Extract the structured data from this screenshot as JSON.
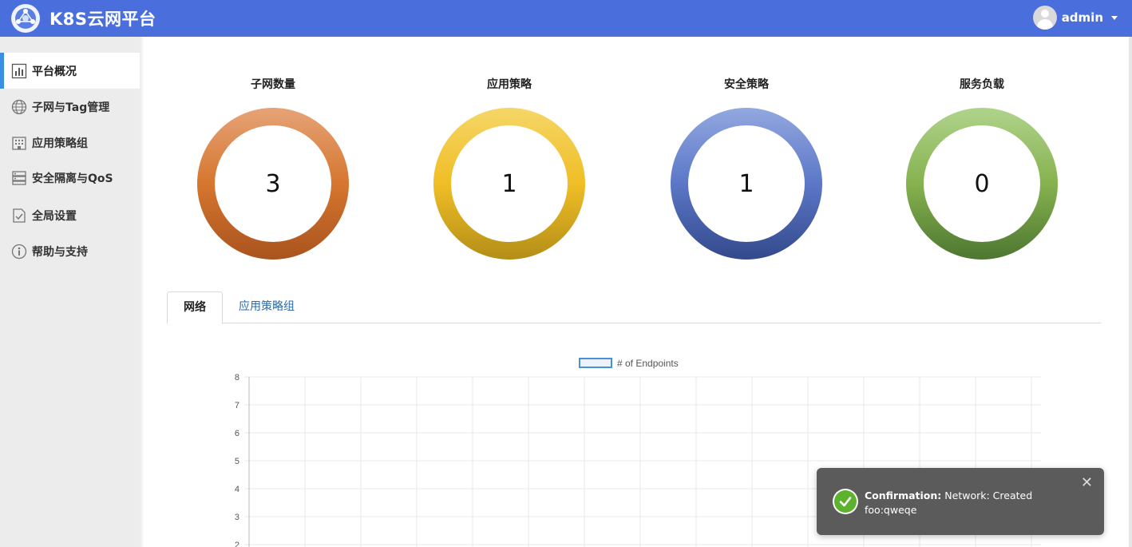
{
  "header": {
    "brand": "K8S云网平台",
    "user": "admin"
  },
  "sidebar": {
    "items": [
      {
        "label": "平台概况",
        "icon": "bar-chart-icon",
        "active": true
      },
      {
        "label": "子网与Tag管理",
        "icon": "globe-icon",
        "active": false
      },
      {
        "label": "应用策略组",
        "icon": "building-icon",
        "active": false
      },
      {
        "label": "安全隔离与QoS",
        "icon": "server-icon",
        "active": false
      },
      {
        "label": "全局设置",
        "icon": "settings-doc-icon",
        "active": false
      },
      {
        "label": "帮助与支持",
        "icon": "info-icon",
        "active": false
      }
    ]
  },
  "stats": [
    {
      "title": "子网数量",
      "value": "3",
      "color": "#d6762f"
    },
    {
      "title": "应用策略",
      "value": "1",
      "color": "#f0be26"
    },
    {
      "title": "安全策略",
      "value": "1",
      "color": "#5b77c7"
    },
    {
      "title": "服务负载",
      "value": "0",
      "color": "#86b24f"
    }
  ],
  "tabs": [
    {
      "label": "网络",
      "active": true
    },
    {
      "label": "应用策略组",
      "active": false
    }
  ],
  "chart_data": {
    "type": "bar",
    "legend": [
      "# of Endpoints"
    ],
    "legend_color": "#4a90d9",
    "y_ticks": [
      "8",
      "7",
      "6",
      "5",
      "4",
      "3",
      "2"
    ],
    "ylim": [
      2,
      8
    ],
    "grid": true,
    "series": [
      {
        "name": "# of Endpoints",
        "values": []
      }
    ]
  },
  "toast": {
    "title": "Confirmation:",
    "message": "Network: Created",
    "detail": "foo:qweqe",
    "close": "✕"
  }
}
